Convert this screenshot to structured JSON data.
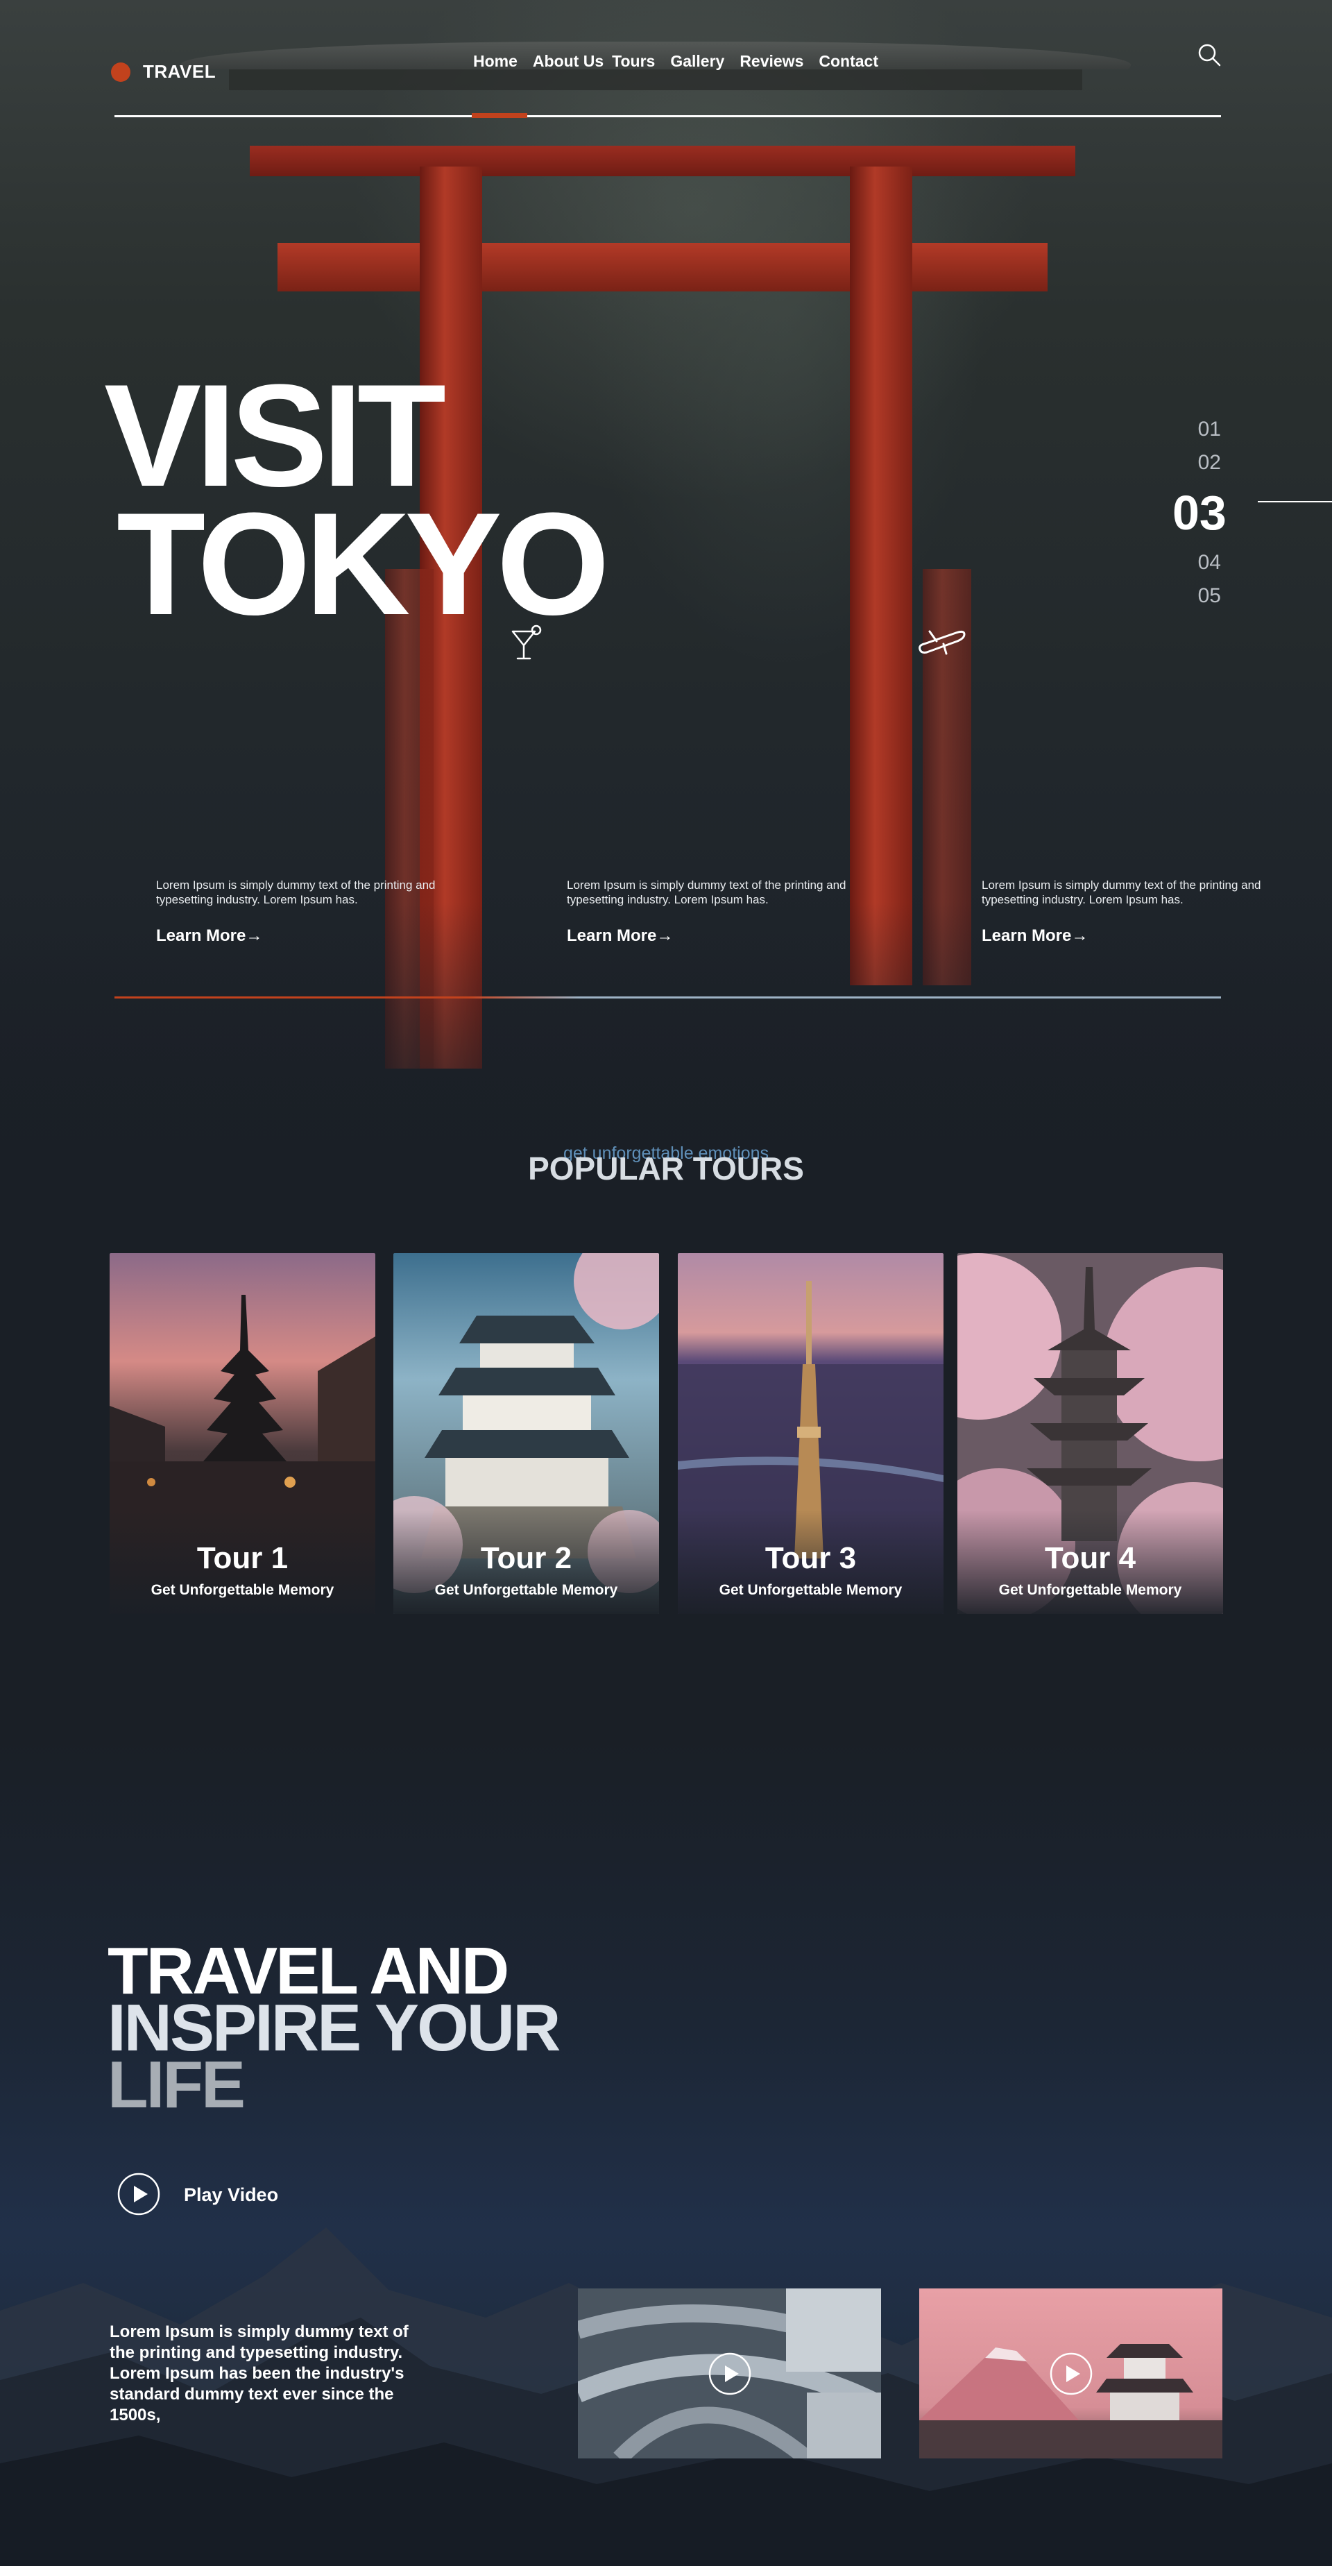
{
  "header": {
    "logo_text": "TRAVEL",
    "nav": [
      "Home",
      "About Us",
      "Tours",
      "Gallery",
      "Reviews",
      "Contact"
    ],
    "active_nav": "Home"
  },
  "hero": {
    "title_line1": "VISIT",
    "title_line2": "TOKYO",
    "slides": [
      "01",
      "02",
      "03",
      "04",
      "05"
    ],
    "active_slide": "03",
    "info": [
      {
        "text": "Lorem Ipsum is simply dummy text of the printing and typesetting industry. Lorem Ipsum has.",
        "link": "Learn More→"
      },
      {
        "text": "Lorem Ipsum is simply dummy text of the printing and typesetting industry. Lorem Ipsum has.",
        "link": "Learn More→"
      },
      {
        "text": "Lorem Ipsum is simply dummy text of the printing and typesetting industry. Lorem Ipsum has.",
        "link": "Learn More→"
      }
    ]
  },
  "tours": {
    "subheading": "get unforgettable emotions",
    "heading": "POPULAR TOURS",
    "cards": [
      {
        "title": "Tour 1",
        "subtitle": "Get Unforgettable Memory"
      },
      {
        "title": "Tour 2",
        "subtitle": "Get Unforgettable Memory"
      },
      {
        "title": "Tour 3",
        "subtitle": "Get Unforgettable Memory"
      },
      {
        "title": "Tour 4",
        "subtitle": "Get Unforgettable Memory"
      }
    ]
  },
  "inspire": {
    "line1": "TRAVEL AND",
    "line2": "INSPIRE YOUR",
    "line3": "LIFE",
    "play_label": "Play Video",
    "text": "Lorem Ipsum is simply dummy text of the printing and typesetting industry. Lorem Ipsum has been the industry's standard dummy text ever since the 1500s,"
  },
  "colors": {
    "accent": "#c2421d",
    "background": "#1a1f26",
    "subheading": "#5f8fb8"
  }
}
